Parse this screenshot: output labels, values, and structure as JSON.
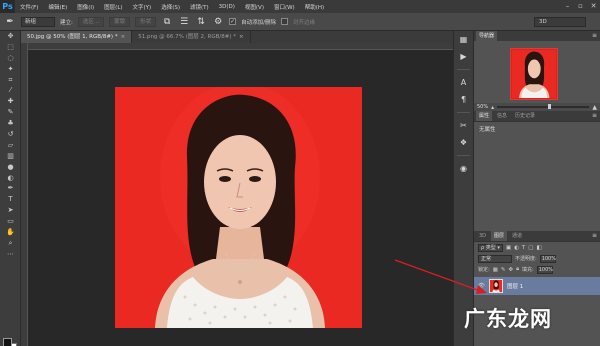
{
  "app": {
    "logo": "Ps"
  },
  "menu": [
    "文件(F)",
    "编辑(E)",
    "图像(I)",
    "图层(L)",
    "文字(Y)",
    "选择(S)",
    "滤镜(T)",
    "3D(D)",
    "视图(V)",
    "窗口(W)",
    "帮助(H)"
  ],
  "options": {
    "style_value": "新组",
    "new_label": "建立:",
    "btn_selection": "选区...",
    "btn_mask": "蒙版",
    "btn_shape": "形状",
    "auto_add_delete": "自动添加/删除",
    "align_edges": "对齐边缘",
    "workspace": "3D"
  },
  "tabs": [
    {
      "label": "50.jpg @ 50% (图层 1, RGB/8#) *",
      "active": true
    },
    {
      "label": "51.png @ 66.7% (图层 2, RGB/8#) *",
      "active": false
    }
  ],
  "navigator": {
    "tab_label": "导航器",
    "zoom": "50%"
  },
  "properties": {
    "tab_labels": [
      "属性",
      "信息",
      "历史记录"
    ],
    "no_properties": "无属性"
  },
  "layers": {
    "tab_labels": [
      "3D",
      "图层",
      "通道"
    ],
    "filter_kind": "类型",
    "blend_mode": "正常",
    "opacity_label": "不透明度:",
    "opacity_value": "100%",
    "lock_label": "锁定:",
    "fill_label": "填充:",
    "fill_value": "100%",
    "layer_name": "图层 1"
  },
  "watermark": "广东龙网",
  "colors": {
    "photo_bg": "#ea2a22",
    "arrow": "#d42020",
    "selected_layer": "#6a7ba0"
  }
}
